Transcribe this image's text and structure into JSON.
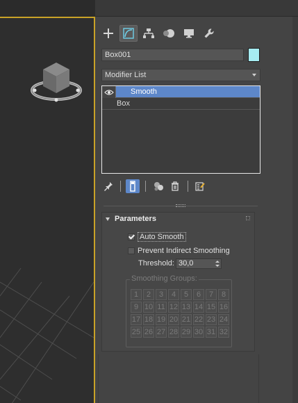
{
  "colors": {
    "viewport_border": "#c9a227",
    "selection": "#5d87c9",
    "object_color": "#a6ecf2"
  },
  "command_panel": {
    "tabs": [
      {
        "name": "create",
        "icon": "plus-icon",
        "active": false
      },
      {
        "name": "modify",
        "icon": "modify-curve-icon",
        "active": true
      },
      {
        "name": "hierarchy",
        "icon": "hierarchy-icon",
        "active": false
      },
      {
        "name": "motion",
        "icon": "motion-icon",
        "active": false
      },
      {
        "name": "display",
        "icon": "display-monitor-icon",
        "active": false
      },
      {
        "name": "utilities",
        "icon": "wrench-icon",
        "active": false
      }
    ],
    "object_name": "Box001",
    "modifier_list_label": "Modifier List",
    "stack": {
      "items": [
        {
          "label": "Smooth",
          "selected": true,
          "has_eye": true
        },
        {
          "label": "Box",
          "selected": false,
          "has_eye": false
        }
      ]
    },
    "stack_tools": [
      {
        "name": "pin-stack",
        "icon": "pin-icon"
      },
      {
        "name": "show-end-result",
        "icon": "show-end-result-icon",
        "active": true
      },
      {
        "name": "make-unique",
        "icon": "make-unique-icon"
      },
      {
        "name": "remove-modifier",
        "icon": "trash-icon"
      },
      {
        "name": "configure-modifier-sets",
        "icon": "configure-sets-icon"
      }
    ]
  },
  "parameters": {
    "title": "Parameters",
    "auto_smooth": {
      "label": "Auto Smooth",
      "checked": true
    },
    "prevent_indirect": {
      "label": "Prevent Indirect Smoothing",
      "checked": false
    },
    "threshold": {
      "label": "Threshold:",
      "value": "30,0"
    },
    "smoothing_groups": {
      "title": "Smoothing Groups:",
      "buttons": [
        "1",
        "2",
        "3",
        "4",
        "5",
        "6",
        "7",
        "8",
        "9",
        "10",
        "11",
        "12",
        "13",
        "14",
        "15",
        "16",
        "17",
        "18",
        "19",
        "20",
        "21",
        "22",
        "23",
        "24",
        "25",
        "26",
        "27",
        "28",
        "29",
        "30",
        "31",
        "32"
      ]
    }
  }
}
